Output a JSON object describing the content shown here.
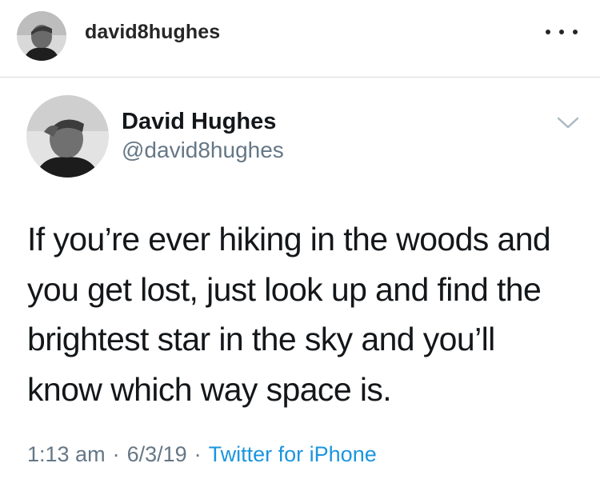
{
  "post_header": {
    "username": "david8hughes",
    "more_icon": "more-horizontal-icon"
  },
  "tweet": {
    "display_name": "David Hughes",
    "handle": "@david8hughes",
    "caret_icon": "chevron-down-icon",
    "text": "If you’re ever hiking in the woods and\nyou get lost, just look up and find the\nbrightest star in the sky and you’ll\nknow which way space is.",
    "time": "1:13 am",
    "date": "6/3/19",
    "separator": "·",
    "source": "Twitter for iPhone"
  },
  "colors": {
    "handle_gray": "#657786",
    "link_blue": "#1b95e0",
    "text_dark": "#14171a",
    "divider": "#dbdbdb"
  }
}
